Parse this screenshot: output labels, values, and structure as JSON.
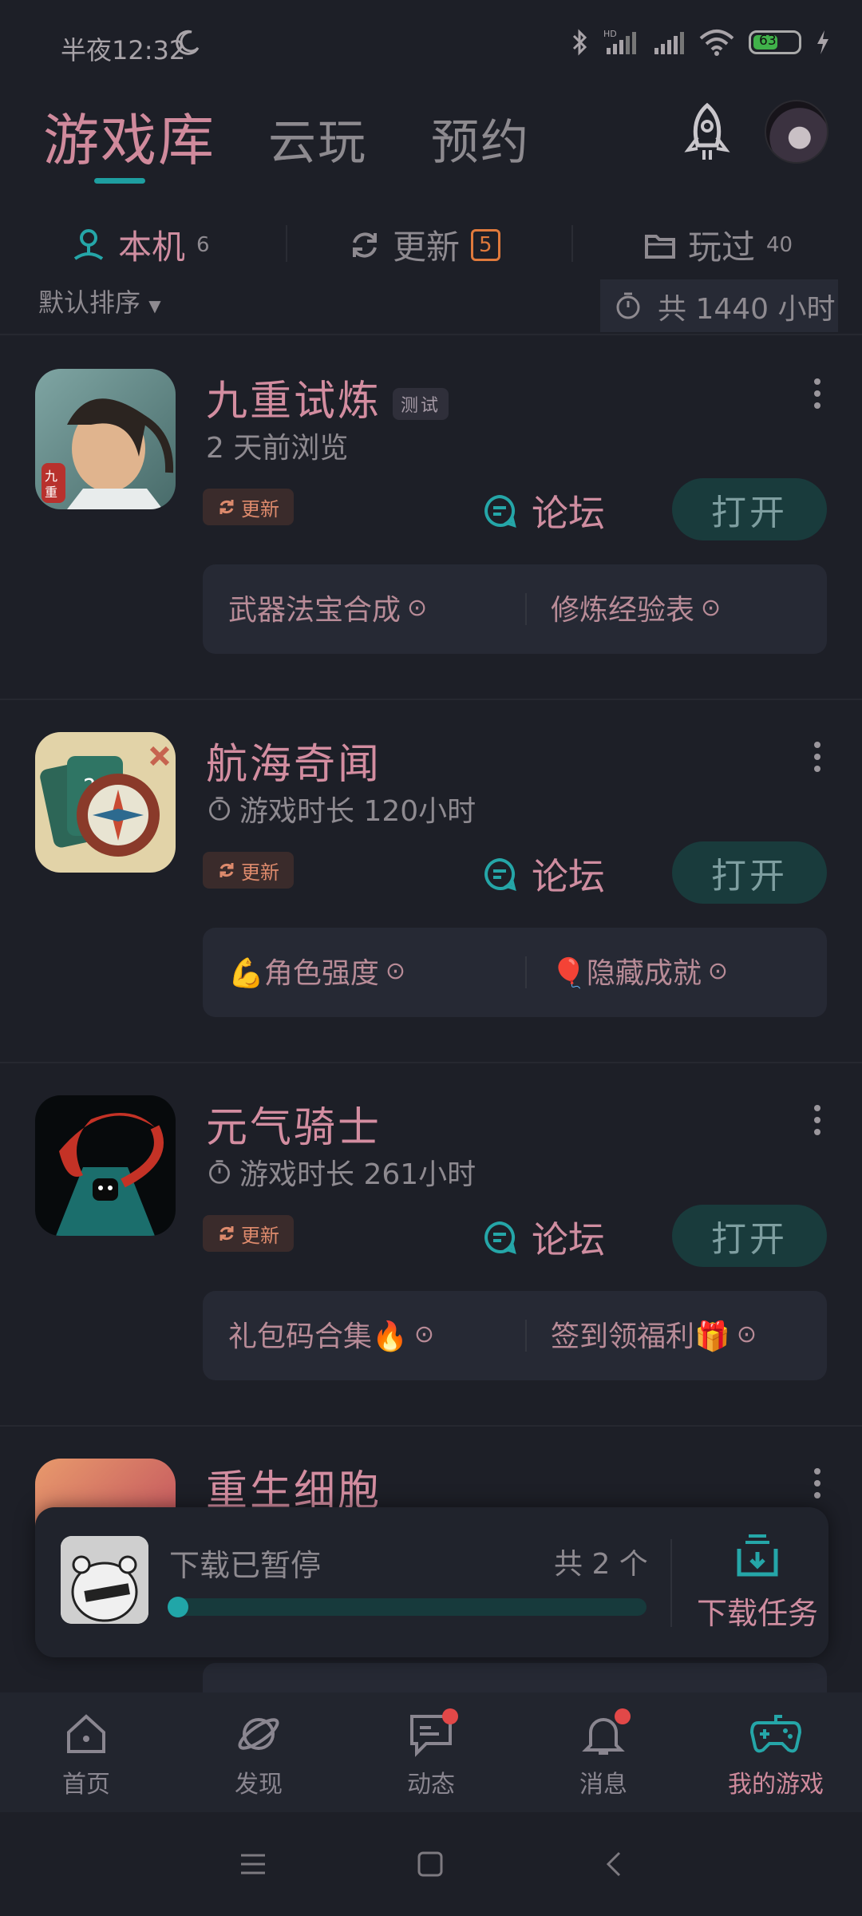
{
  "status": {
    "time": "半夜12:32",
    "battery": "63"
  },
  "topnav": {
    "tabs": [
      "游戏库",
      "云玩",
      "预约"
    ]
  },
  "subtabs": [
    {
      "label": "本机",
      "count": "6"
    },
    {
      "label": "更新",
      "count": "5"
    },
    {
      "label": "玩过",
      "count": "40"
    }
  ],
  "sort": {
    "label": "默认排序",
    "total": "共 1440 小时"
  },
  "games": [
    {
      "name": "九重试炼",
      "tag": "测试",
      "subtitle": "2 天前浏览",
      "update": "更新",
      "forum": "论坛",
      "open": "打开",
      "links": [
        "武器法宝合成",
        "修炼经验表"
      ]
    },
    {
      "name": "航海奇闻",
      "subtitle": "游戏时长 120小时",
      "update": "更新",
      "forum": "论坛",
      "open": "打开",
      "links": [
        "💪角色强度",
        "🎈隐藏成就"
      ]
    },
    {
      "name": "元气骑士",
      "subtitle": "游戏时长 261小时",
      "update": "更新",
      "forum": "论坛",
      "open": "打开",
      "links": [
        "礼包码合集🔥",
        "签到领福利🎁"
      ]
    },
    {
      "name": "重生细胞"
    }
  ],
  "download": {
    "status": "下载已暂停",
    "count": "共 2 个",
    "task_label": "下载任务",
    "progress": 0.0
  },
  "bottomnav": [
    {
      "label": "首页",
      "icon": "home-icon"
    },
    {
      "label": "发现",
      "icon": "planet-icon"
    },
    {
      "label": "动态",
      "icon": "chat-icon"
    },
    {
      "label": "消息",
      "icon": "bell-icon"
    },
    {
      "label": "我的游戏",
      "icon": "gamepad-icon"
    }
  ],
  "colors": {
    "accent": "#25a6a8",
    "text_pink": "#cf8da0",
    "background": "#1d1f27"
  }
}
